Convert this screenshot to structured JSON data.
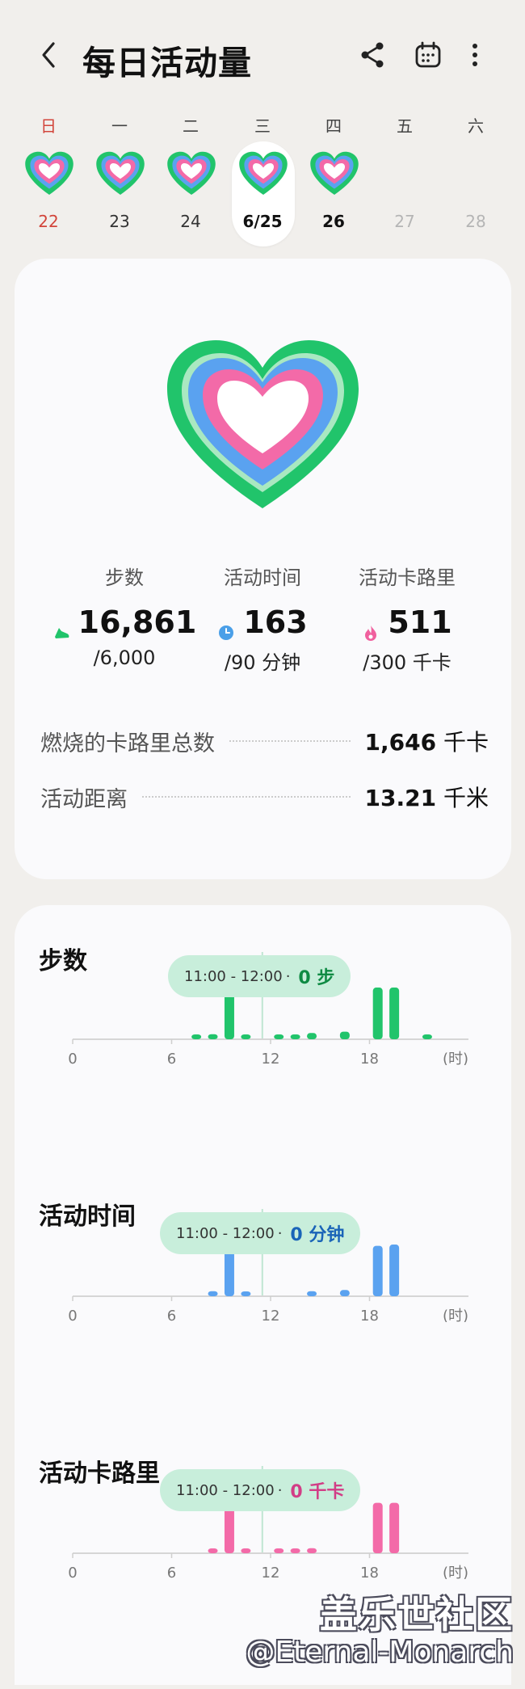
{
  "header": {
    "title": "每日活动量",
    "icons": [
      "back-icon",
      "share-icon",
      "calendar-icon",
      "more-icon"
    ]
  },
  "week": {
    "days": [
      {
        "weekday": "日",
        "date": "22"
      },
      {
        "weekday": "一",
        "date": "23"
      },
      {
        "weekday": "二",
        "date": "24"
      },
      {
        "weekday": "三",
        "date": "6/25"
      },
      {
        "weekday": "四",
        "date": "26"
      },
      {
        "weekday": "五",
        "date": "27"
      },
      {
        "weekday": "六",
        "date": "28"
      }
    ]
  },
  "summary": {
    "stats": [
      {
        "label": "步数",
        "value": "16,861",
        "goal": "/6,000",
        "color": "#21c46b",
        "icon": "shoe-icon"
      },
      {
        "label": "活动时间",
        "value": "163",
        "goal": "/90 分钟",
        "color": "#4a9fe8",
        "icon": "clock-icon"
      },
      {
        "label": "活动卡路里",
        "value": "511",
        "goal": "/300 千卡",
        "color": "#f0609e",
        "icon": "flame-icon"
      }
    ],
    "rows": [
      {
        "label": "燃烧的卡路里总数",
        "value": "1,646",
        "unit": "千卡"
      },
      {
        "label": "活动距离",
        "value": "13.21",
        "unit": "千米"
      }
    ]
  },
  "colors": {
    "steps": "#21c46b",
    "time": "#5aa2f0",
    "calories": "#f36aa8",
    "bubble": "#c8eedb"
  },
  "chart_data": [
    {
      "type": "bar",
      "title": "步数",
      "x_ticks": [
        "0",
        "6",
        "12",
        "18",
        "(时)"
      ],
      "hours": [
        7,
        8,
        9,
        10,
        12,
        13,
        14,
        16,
        18,
        19,
        21
      ],
      "values": [
        0.06,
        0.08,
        1.0,
        0.06,
        0.06,
        0.06,
        0.1,
        0.12,
        0.82,
        0.82,
        0.06
      ],
      "tooltip": {
        "range": "11:00 - 12:00",
        "value": "0 步"
      }
    },
    {
      "type": "bar",
      "title": "活动时间",
      "x_ticks": [
        "0",
        "6",
        "12",
        "18",
        "(时)"
      ],
      "hours": [
        8,
        9,
        10,
        14,
        16,
        18,
        19
      ],
      "values": [
        0.08,
        1.0,
        0.06,
        0.08,
        0.1,
        0.8,
        0.82
      ],
      "tooltip": {
        "range": "11:00 - 12:00",
        "value": "0 分钟"
      }
    },
    {
      "type": "bar",
      "title": "活动卡路里",
      "x_ticks": [
        "0",
        "6",
        "12",
        "18",
        "(时)"
      ],
      "hours": [
        8,
        9,
        10,
        12,
        13,
        14,
        18,
        19
      ],
      "values": [
        0.06,
        1.0,
        0.06,
        0.06,
        0.06,
        0.08,
        0.8,
        0.8
      ],
      "tooltip": {
        "range": "11:00 - 12:00",
        "value": "0 千卡"
      }
    }
  ],
  "watermark": {
    "line1": "盖乐世社区",
    "line2": "@Eternal-Monarch"
  }
}
